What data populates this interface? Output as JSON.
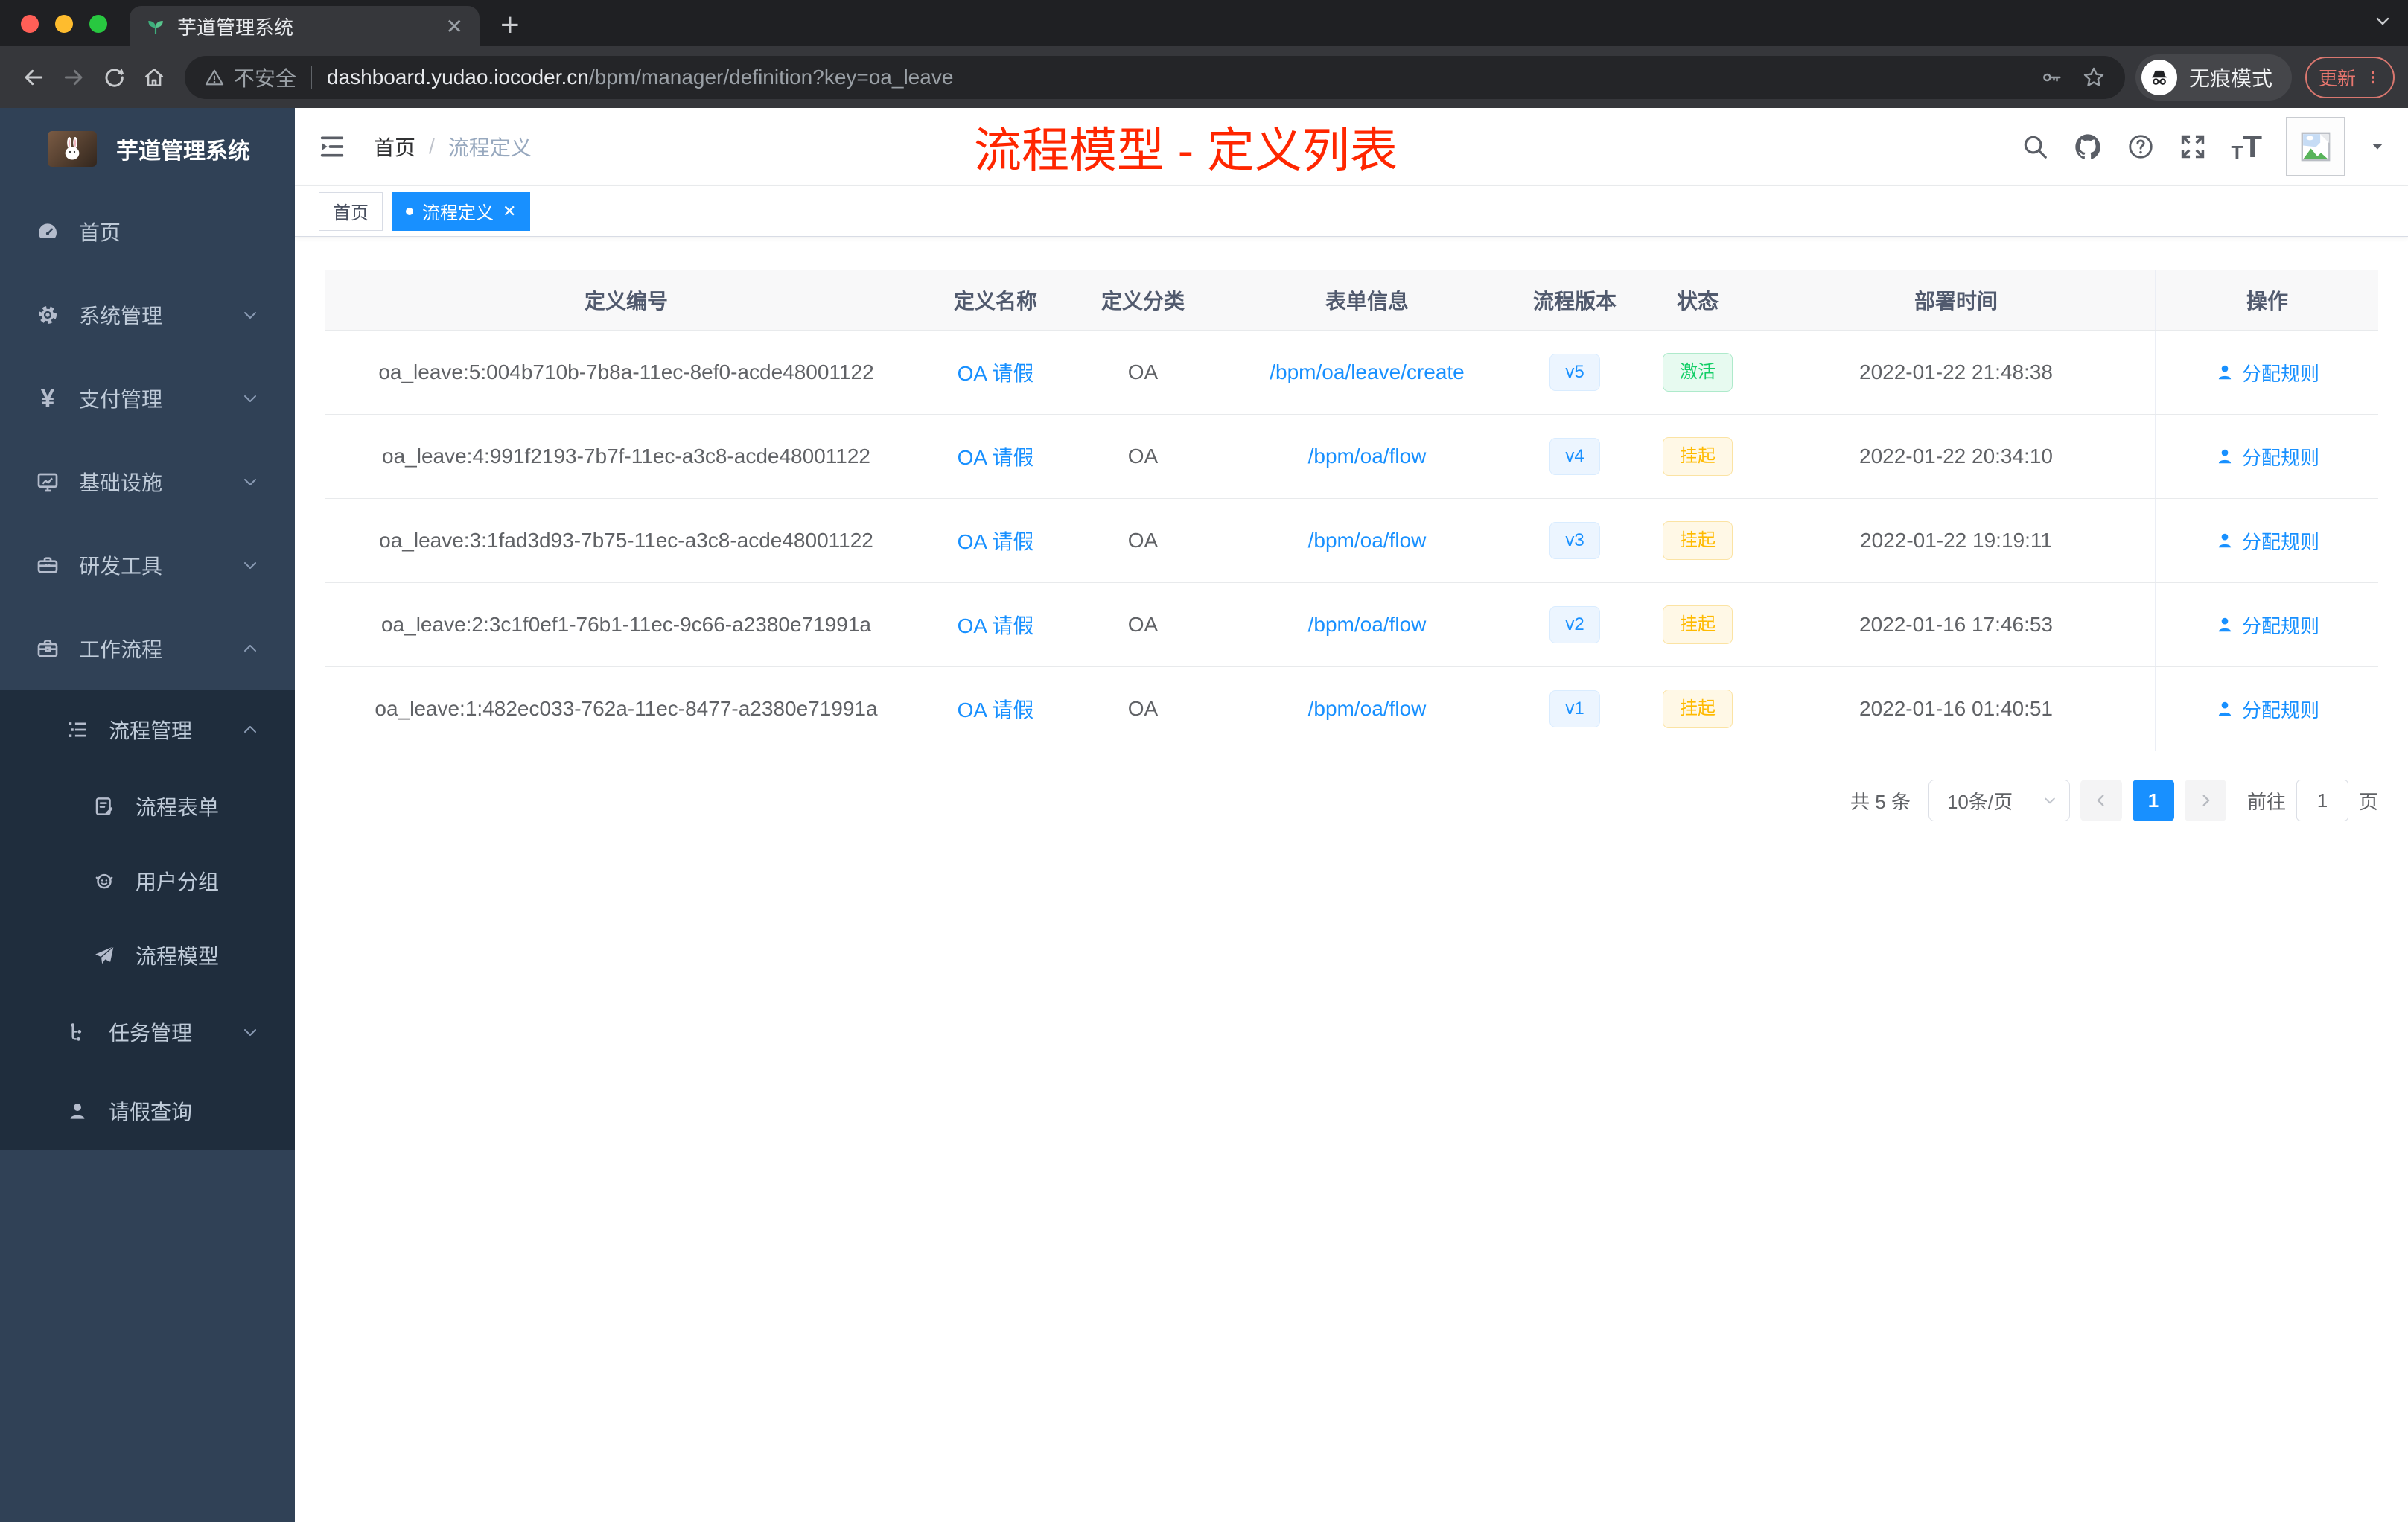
{
  "browser": {
    "tab_title": "芋道管理系统",
    "security_label": "不安全",
    "url_host": "dashboard.yudao.iocoder.cn",
    "url_path": "/bpm/manager/definition?key=oa_leave",
    "incognito_label": "无痕模式",
    "update_label": "更新"
  },
  "sidebar": {
    "logo_title": "芋道管理系统",
    "items": [
      {
        "label": "首页",
        "icon": "dashboard-icon"
      },
      {
        "label": "系统管理",
        "icon": "gear-icon"
      },
      {
        "label": "支付管理",
        "icon": "yen-icon",
        "glyph": "¥"
      },
      {
        "label": "基础设施",
        "icon": "monitor-icon"
      },
      {
        "label": "研发工具",
        "icon": "toolbox-icon"
      },
      {
        "label": "工作流程",
        "icon": "briefcase-icon"
      },
      {
        "label": "流程管理",
        "icon": "tree-list-icon"
      },
      {
        "label": "流程表单",
        "icon": "form-doc-icon"
      },
      {
        "label": "用户分组",
        "icon": "robot-icon"
      },
      {
        "label": "流程模型",
        "icon": "paper-plane-icon"
      },
      {
        "label": "任务管理",
        "icon": "flow-icon"
      },
      {
        "label": "请假查询",
        "icon": "user-icon"
      }
    ]
  },
  "header": {
    "breadcrumb_home": "首页",
    "breadcrumb_separator": "/",
    "breadcrumb_current": "流程定义",
    "annotation": "流程模型 - 定义列表"
  },
  "tags": {
    "home": "首页",
    "active": "流程定义"
  },
  "table": {
    "columns": [
      "定义编号",
      "定义名称",
      "定义分类",
      "表单信息",
      "流程版本",
      "状态",
      "部署时间",
      "操作"
    ],
    "rows": [
      {
        "id": "oa_leave:5:004b710b-7b8a-11ec-8ef0-acde48001122",
        "name": "OA 请假",
        "category": "OA",
        "form": "/bpm/oa/leave/create",
        "version": "v5",
        "status": "激活",
        "status_type": "success",
        "time": "2022-01-22 21:48:38",
        "action": "分配规则"
      },
      {
        "id": "oa_leave:4:991f2193-7b7f-11ec-a3c8-acde48001122",
        "name": "OA 请假",
        "category": "OA",
        "form": "/bpm/oa/flow",
        "version": "v4",
        "status": "挂起",
        "status_type": "warning",
        "time": "2022-01-22 20:34:10",
        "action": "分配规则"
      },
      {
        "id": "oa_leave:3:1fad3d93-7b75-11ec-a3c8-acde48001122",
        "name": "OA 请假",
        "category": "OA",
        "form": "/bpm/oa/flow",
        "version": "v3",
        "status": "挂起",
        "status_type": "warning",
        "time": "2022-01-22 19:19:11",
        "action": "分配规则"
      },
      {
        "id": "oa_leave:2:3c1f0ef1-76b1-11ec-9c66-a2380e71991a",
        "name": "OA 请假",
        "category": "OA",
        "form": "/bpm/oa/flow",
        "version": "v2",
        "status": "挂起",
        "status_type": "warning",
        "time": "2022-01-16 17:46:53",
        "action": "分配规则"
      },
      {
        "id": "oa_leave:1:482ec033-762a-11ec-8477-a2380e71991a",
        "name": "OA 请假",
        "category": "OA",
        "form": "/bpm/oa/flow",
        "version": "v1",
        "status": "挂起",
        "status_type": "warning",
        "time": "2022-01-16 01:40:51",
        "action": "分配规则"
      }
    ]
  },
  "pagination": {
    "total": "共 5 条",
    "page_size": "10条/页",
    "page": "1",
    "goto_label": "前往",
    "goto_value": "1",
    "page_unit": "页"
  },
  "colors": {
    "accent_blue": "#1890ff",
    "success_green": "#13ce66",
    "warning_yellow": "#ffba00",
    "annotation_red": "#ff2600",
    "sidebar_bg": "#304156",
    "submenu_bg": "#1f2d3d"
  }
}
